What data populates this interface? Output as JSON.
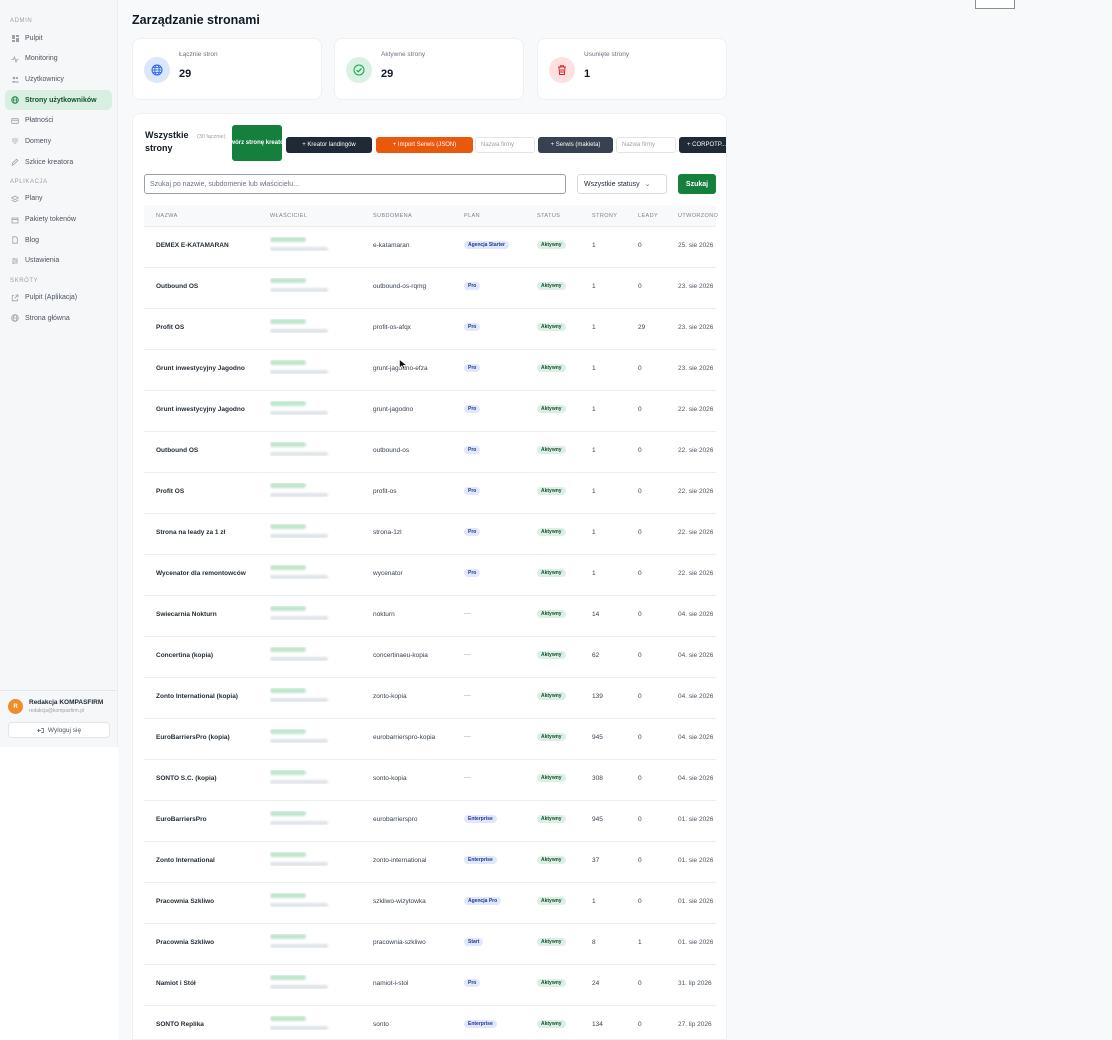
{
  "sidebar": {
    "sections": [
      {
        "label": "ADMIN",
        "items": [
          {
            "label": "Pulpit",
            "icon": "dashboard-icon"
          },
          {
            "label": "Monitoring",
            "icon": "activity-icon"
          },
          {
            "label": "Użytkownicy",
            "icon": "users-icon"
          },
          {
            "label": "Strony użytkowników",
            "icon": "globe-icon",
            "active": true
          },
          {
            "label": "Płatności",
            "icon": "card-icon"
          },
          {
            "label": "Domeny",
            "icon": "domain-icon"
          },
          {
            "label": "Szkice kreatora",
            "icon": "edit-icon"
          }
        ]
      },
      {
        "label": "APLIKACJA",
        "items": [
          {
            "label": "Plany",
            "icon": "layers-icon"
          },
          {
            "label": "Pakiety tokenów",
            "icon": "package-icon"
          },
          {
            "label": "Blog",
            "icon": "file-icon"
          },
          {
            "label": "Ustawienia",
            "icon": "settings-icon"
          }
        ]
      },
      {
        "label": "SKRÓTY",
        "items": [
          {
            "label": "Pulpit (Aplikacja)",
            "icon": "external-icon"
          },
          {
            "label": "Strona główna",
            "icon": "globe-icon"
          }
        ]
      }
    ],
    "user": {
      "initial": "R",
      "name": "Redakcja KOMPASFIRM",
      "email": "redakcja@kompasfirm.pl"
    },
    "logout_label": "Wyloguj się"
  },
  "page": {
    "title": "Zarządzanie stronami"
  },
  "stats": [
    {
      "label": "Łącznie stron",
      "value": "29",
      "icon": "globe-icon",
      "bg": "#dbe7fb",
      "fg": "#2563eb"
    },
    {
      "label": "Aktywne strony",
      "value": "29",
      "icon": "check-circle-icon",
      "bg": "#d9f2e2",
      "fg": "#16a34a"
    },
    {
      "label": "Usunięte strony",
      "value": "1",
      "icon": "trash-icon",
      "bg": "#fde1e1",
      "fg": "#dc2626"
    }
  ],
  "card": {
    "title": "Wszystkie strony",
    "count": "(30 łącznie)",
    "create_label": "+ Stwórz stronę kreatorem",
    "landing_label": "+ Kreator landingów",
    "import_label": "+ Import Serwis (JSON)",
    "company_placeholder_1": "Nazwa firmy",
    "mockup_label": "+ Serwis (makieta)",
    "company_placeholder_2": "Nazwa firmy",
    "corporate_label": "+ CORPOTP..."
  },
  "filters": {
    "search_placeholder": "Szukaj po nazwie, subdomenie lub właścicielu...",
    "status_value": "Wszystkie statusy",
    "search_button": "Szukaj"
  },
  "table": {
    "columns": [
      "NAZWA",
      "WŁAŚCICIEL",
      "SUBDOMENA",
      "PLAN",
      "STATUS",
      "STRONY",
      "LEADY",
      "UTWORZONO"
    ],
    "rows": [
      {
        "name": "DEMEX E-KATAMARAN",
        "sub": "e-katamaran",
        "plan": "Agencja Starter",
        "status": "Aktywny",
        "pages": "1",
        "leads": "0",
        "date": "25. sie 2026"
      },
      {
        "name": "Outbound OS",
        "sub": "outbound-os-rqmg",
        "plan": "Pro",
        "status": "Aktywny",
        "pages": "1",
        "leads": "0",
        "date": "23. sie 2026"
      },
      {
        "name": "Profit OS",
        "sub": "profit-os-afqx",
        "plan": "Pro",
        "status": "Aktywny",
        "pages": "1",
        "leads": "29",
        "date": "23. sie 2026"
      },
      {
        "name": "Grunt inwestycyjny Jagodno",
        "sub": "grunt-jagodno-efza",
        "plan": "Pro",
        "status": "Aktywny",
        "pages": "1",
        "leads": "0",
        "date": "23. sie 2026"
      },
      {
        "name": "Grunt inwestycyjny Jagodno",
        "sub": "grunt-jagodno",
        "plan": "Pro",
        "status": "Aktywny",
        "pages": "1",
        "leads": "0",
        "date": "22. sie 2026"
      },
      {
        "name": "Outbound OS",
        "sub": "outbound-os",
        "plan": "Pro",
        "status": "Aktywny",
        "pages": "1",
        "leads": "0",
        "date": "22. sie 2026"
      },
      {
        "name": "Profit OS",
        "sub": "profit-os",
        "plan": "Pro",
        "status": "Aktywny",
        "pages": "1",
        "leads": "0",
        "date": "22. sie 2026"
      },
      {
        "name": "Strona na leady za 1 zł",
        "sub": "strona-1zl",
        "plan": "Pro",
        "status": "Aktywny",
        "pages": "1",
        "leads": "0",
        "date": "22. sie 2026"
      },
      {
        "name": "Wycenator dla remontowców",
        "sub": "wycenator",
        "plan": "Pro",
        "status": "Aktywny",
        "pages": "1",
        "leads": "0",
        "date": "22. sie 2026"
      },
      {
        "name": "Świecarnia Nokturn",
        "sub": "nokturn",
        "plan": "—",
        "status": "Aktywny",
        "pages": "14",
        "leads": "0",
        "date": "04. sie 2026"
      },
      {
        "name": "Concertina (kopia)",
        "sub": "concertinaeu-kopia",
        "plan": "—",
        "status": "Aktywny",
        "pages": "62",
        "leads": "0",
        "date": "04. sie 2026"
      },
      {
        "name": "Zonto International (kopia)",
        "sub": "zonto-kopia",
        "plan": "—",
        "status": "Aktywny",
        "pages": "139",
        "leads": "0",
        "date": "04. sie 2026"
      },
      {
        "name": "EuroBarriersPro (kopia)",
        "sub": "eurobarrierspro-kopia",
        "plan": "—",
        "status": "Aktywny",
        "pages": "945",
        "leads": "0",
        "date": "04. sie 2026"
      },
      {
        "name": "SONTO S.C. (kopia)",
        "sub": "sonto-kopia",
        "plan": "—",
        "status": "Aktywny",
        "pages": "308",
        "leads": "0",
        "date": "04. sie 2026"
      },
      {
        "name": "EuroBarriersPro",
        "sub": "eurobarrierspro",
        "plan": "Enterprise",
        "status": "Aktywny",
        "pages": "945",
        "leads": "0",
        "date": "01. sie 2026"
      },
      {
        "name": "Zonto International",
        "sub": "zonto-international",
        "plan": "Enterprise",
        "status": "Aktywny",
        "pages": "37",
        "leads": "0",
        "date": "01. sie 2026"
      },
      {
        "name": "Pracownia Szkliwo",
        "sub": "szkliwo-wizytowka",
        "plan": "Agencja Pro",
        "status": "Aktywny",
        "pages": "1",
        "leads": "0",
        "date": "01. sie 2026"
      },
      {
        "name": "Pracownia Szkliwo",
        "sub": "pracownia-szkliwo",
        "plan": "Start",
        "status": "Aktywny",
        "pages": "8",
        "leads": "1",
        "date": "01. sie 2026"
      },
      {
        "name": "Namiot i Stół",
        "sub": "namiot-i-stol",
        "plan": "Pro",
        "status": "Aktywny",
        "pages": "24",
        "leads": "0",
        "date": "31. lip 2026"
      },
      {
        "name": "SONTO Replika",
        "sub": "sonto",
        "plan": "Enterprise",
        "status": "Aktywny",
        "pages": "134",
        "leads": "0",
        "date": "27. lip 2026"
      }
    ]
  }
}
